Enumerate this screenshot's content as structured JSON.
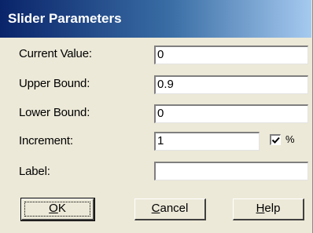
{
  "window": {
    "title": "Slider Parameters"
  },
  "fields": {
    "current_value": {
      "label": "Current Value:",
      "value": "0"
    },
    "upper_bound": {
      "label": "Upper Bound:",
      "value": "0.9"
    },
    "lower_bound": {
      "label": "Lower Bound:",
      "value": "0"
    },
    "increment": {
      "label": "Increment:",
      "value": "1"
    },
    "label": {
      "label": "Label:",
      "value": ""
    }
  },
  "percent": {
    "label": "%",
    "checked": true
  },
  "buttons": {
    "ok": {
      "mnemonic": "O",
      "rest": "K"
    },
    "cancel": {
      "mnemonic": "C",
      "rest": "ancel"
    },
    "help": {
      "mnemonic": "H",
      "rest": "elp"
    }
  },
  "colors": {
    "dialog_bg": "#ece9d8",
    "title_start": "#0a246a",
    "title_end": "#a6caf0"
  }
}
